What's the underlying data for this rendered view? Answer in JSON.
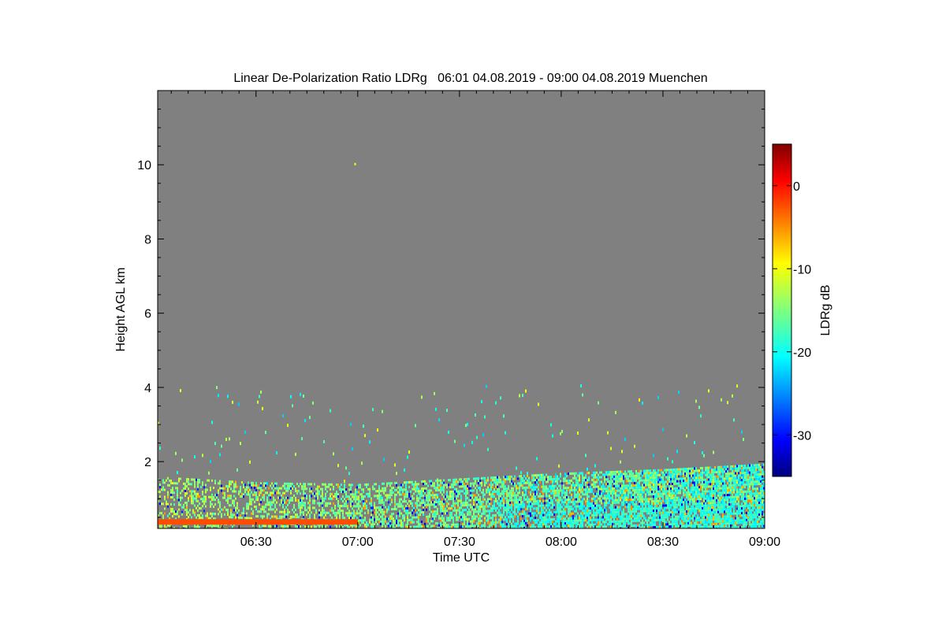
{
  "chart_data": {
    "type": "heatmap",
    "title": "Linear De-Polarization Ratio LDRg   06:01 04.08.2019 - 09:00 04.08.2019 Muenchen",
    "xlabel": "Time UTC",
    "ylabel": "Height AGL km",
    "x_ticks": [
      "06:30",
      "07:00",
      "07:30",
      "08:00",
      "08:30",
      "09:00"
    ],
    "x_range": [
      "06:01",
      "09:00"
    ],
    "y_ticks": [
      2,
      4,
      6,
      8,
      10
    ],
    "ylim": [
      0.2,
      12.0
    ],
    "background_color": "#808080",
    "colorbar": {
      "label": "LDRg dB",
      "ticks": [
        0,
        -10,
        -20,
        -30
      ],
      "range": [
        -35,
        5
      ],
      "colormap": "jet"
    },
    "data_description_layers": {
      "dense_layer_top_km_by_time": [
        {
          "time": "06:01",
          "top_km": 1.6
        },
        {
          "time": "06:30",
          "top_km": 1.45
        },
        {
          "time": "07:00",
          "top_km": 1.4
        },
        {
          "time": "07:30",
          "top_km": 1.55
        },
        {
          "time": "08:00",
          "top_km": 1.7
        },
        {
          "time": "08:30",
          "top_km": 1.8
        },
        {
          "time": "09:00",
          "top_km": 1.95
        }
      ],
      "surface_band_km": [
        0.3,
        0.45
      ],
      "surface_band_ldr_db": -3,
      "surface_band_end": "07:00",
      "sparse_echo_top_km": 4.1,
      "isolated_echo": {
        "time": "06:59",
        "height_km": 10.05,
        "ldr_db": -10
      }
    }
  }
}
